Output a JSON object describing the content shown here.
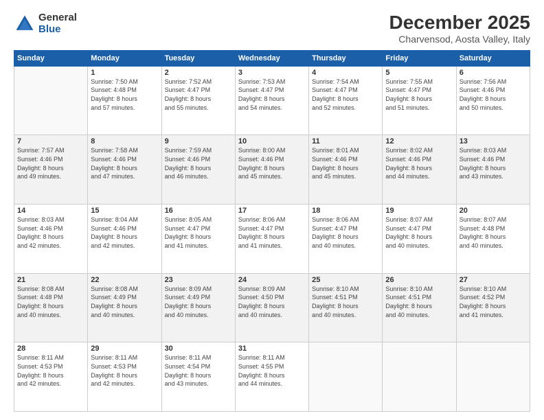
{
  "logo": {
    "general": "General",
    "blue": "Blue"
  },
  "header": {
    "title": "December 2025",
    "subtitle": "Charvensod, Aosta Valley, Italy"
  },
  "weekdays": [
    "Sunday",
    "Monday",
    "Tuesday",
    "Wednesday",
    "Thursday",
    "Friday",
    "Saturday"
  ],
  "weeks": [
    [
      {
        "day": "",
        "info": ""
      },
      {
        "day": "1",
        "info": "Sunrise: 7:50 AM\nSunset: 4:48 PM\nDaylight: 8 hours\nand 57 minutes."
      },
      {
        "day": "2",
        "info": "Sunrise: 7:52 AM\nSunset: 4:47 PM\nDaylight: 8 hours\nand 55 minutes."
      },
      {
        "day": "3",
        "info": "Sunrise: 7:53 AM\nSunset: 4:47 PM\nDaylight: 8 hours\nand 54 minutes."
      },
      {
        "day": "4",
        "info": "Sunrise: 7:54 AM\nSunset: 4:47 PM\nDaylight: 8 hours\nand 52 minutes."
      },
      {
        "day": "5",
        "info": "Sunrise: 7:55 AM\nSunset: 4:47 PM\nDaylight: 8 hours\nand 51 minutes."
      },
      {
        "day": "6",
        "info": "Sunrise: 7:56 AM\nSunset: 4:46 PM\nDaylight: 8 hours\nand 50 minutes."
      }
    ],
    [
      {
        "day": "7",
        "info": "Sunrise: 7:57 AM\nSunset: 4:46 PM\nDaylight: 8 hours\nand 49 minutes."
      },
      {
        "day": "8",
        "info": "Sunrise: 7:58 AM\nSunset: 4:46 PM\nDaylight: 8 hours\nand 47 minutes."
      },
      {
        "day": "9",
        "info": "Sunrise: 7:59 AM\nSunset: 4:46 PM\nDaylight: 8 hours\nand 46 minutes."
      },
      {
        "day": "10",
        "info": "Sunrise: 8:00 AM\nSunset: 4:46 PM\nDaylight: 8 hours\nand 45 minutes."
      },
      {
        "day": "11",
        "info": "Sunrise: 8:01 AM\nSunset: 4:46 PM\nDaylight: 8 hours\nand 45 minutes."
      },
      {
        "day": "12",
        "info": "Sunrise: 8:02 AM\nSunset: 4:46 PM\nDaylight: 8 hours\nand 44 minutes."
      },
      {
        "day": "13",
        "info": "Sunrise: 8:03 AM\nSunset: 4:46 PM\nDaylight: 8 hours\nand 43 minutes."
      }
    ],
    [
      {
        "day": "14",
        "info": "Sunrise: 8:03 AM\nSunset: 4:46 PM\nDaylight: 8 hours\nand 42 minutes."
      },
      {
        "day": "15",
        "info": "Sunrise: 8:04 AM\nSunset: 4:46 PM\nDaylight: 8 hours\nand 42 minutes."
      },
      {
        "day": "16",
        "info": "Sunrise: 8:05 AM\nSunset: 4:47 PM\nDaylight: 8 hours\nand 41 minutes."
      },
      {
        "day": "17",
        "info": "Sunrise: 8:06 AM\nSunset: 4:47 PM\nDaylight: 8 hours\nand 41 minutes."
      },
      {
        "day": "18",
        "info": "Sunrise: 8:06 AM\nSunset: 4:47 PM\nDaylight: 8 hours\nand 40 minutes."
      },
      {
        "day": "19",
        "info": "Sunrise: 8:07 AM\nSunset: 4:47 PM\nDaylight: 8 hours\nand 40 minutes."
      },
      {
        "day": "20",
        "info": "Sunrise: 8:07 AM\nSunset: 4:48 PM\nDaylight: 8 hours\nand 40 minutes."
      }
    ],
    [
      {
        "day": "21",
        "info": "Sunrise: 8:08 AM\nSunset: 4:48 PM\nDaylight: 8 hours\nand 40 minutes."
      },
      {
        "day": "22",
        "info": "Sunrise: 8:08 AM\nSunset: 4:49 PM\nDaylight: 8 hours\nand 40 minutes."
      },
      {
        "day": "23",
        "info": "Sunrise: 8:09 AM\nSunset: 4:49 PM\nDaylight: 8 hours\nand 40 minutes."
      },
      {
        "day": "24",
        "info": "Sunrise: 8:09 AM\nSunset: 4:50 PM\nDaylight: 8 hours\nand 40 minutes."
      },
      {
        "day": "25",
        "info": "Sunrise: 8:10 AM\nSunset: 4:51 PM\nDaylight: 8 hours\nand 40 minutes."
      },
      {
        "day": "26",
        "info": "Sunrise: 8:10 AM\nSunset: 4:51 PM\nDaylight: 8 hours\nand 40 minutes."
      },
      {
        "day": "27",
        "info": "Sunrise: 8:10 AM\nSunset: 4:52 PM\nDaylight: 8 hours\nand 41 minutes."
      }
    ],
    [
      {
        "day": "28",
        "info": "Sunrise: 8:11 AM\nSunset: 4:53 PM\nDaylight: 8 hours\nand 42 minutes."
      },
      {
        "day": "29",
        "info": "Sunrise: 8:11 AM\nSunset: 4:53 PM\nDaylight: 8 hours\nand 42 minutes."
      },
      {
        "day": "30",
        "info": "Sunrise: 8:11 AM\nSunset: 4:54 PM\nDaylight: 8 hours\nand 43 minutes."
      },
      {
        "day": "31",
        "info": "Sunrise: 8:11 AM\nSunset: 4:55 PM\nDaylight: 8 hours\nand 44 minutes."
      },
      {
        "day": "",
        "info": ""
      },
      {
        "day": "",
        "info": ""
      },
      {
        "day": "",
        "info": ""
      }
    ]
  ]
}
